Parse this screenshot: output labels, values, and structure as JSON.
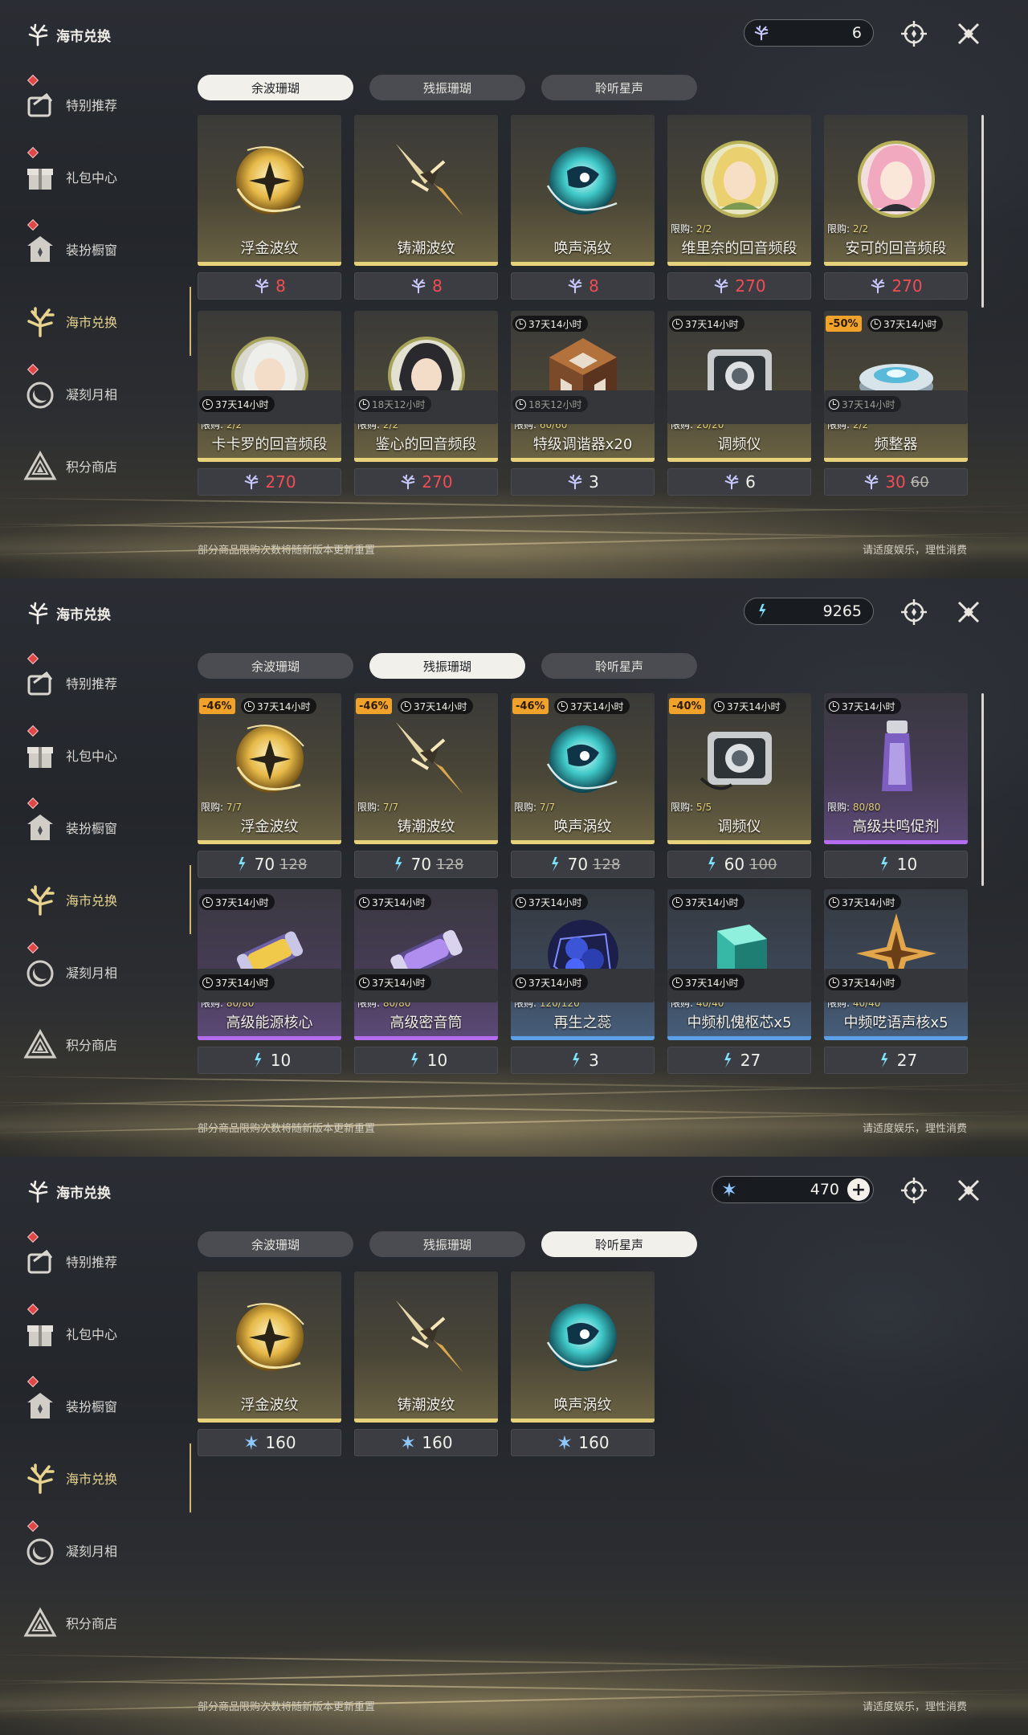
{
  "app_title": "海市兑换",
  "sidebar": [
    {
      "label": "特别推荐",
      "icon": "featured-icon",
      "dot": true
    },
    {
      "label": "礼包中心",
      "icon": "gift-box-icon",
      "dot": true
    },
    {
      "label": "装扮橱窗",
      "icon": "wardrobe-icon",
      "dot": true
    },
    {
      "label": "海市兑换",
      "icon": "coral-exchange-icon",
      "active": true
    },
    {
      "label": "凝刻月相",
      "icon": "moon-phase-icon",
      "dot": true
    },
    {
      "label": "积分商店",
      "icon": "points-shop-icon"
    }
  ],
  "tabs": [
    "余波珊瑚",
    "残振珊瑚",
    "聆听星声"
  ],
  "footer": {
    "left": "部分商品限购次数将随新版本更新重置",
    "right": "请适度娱乐，理性消费"
  },
  "colors": {
    "accent": "#e9d48f",
    "price_red": "#f04d55",
    "discount": "#f0a22b",
    "gold_bar": "#e7d27b",
    "purple_bar": "#b46cf0",
    "blue_bar": "#5b9fe6"
  },
  "panels": [
    {
      "currency": {
        "icon": "afterglow-coral-icon",
        "value": "6",
        "plus": false
      },
      "active_tab": 0,
      "items": [
        {
          "name": "浮金波纹",
          "art": "gold-orb",
          "price": "8",
          "price_red": true,
          "currency_icon": "afterglow-coral-icon"
        },
        {
          "name": "铸潮波纹",
          "art": "gold-blade",
          "price": "8",
          "price_red": true,
          "currency_icon": "afterglow-coral-icon"
        },
        {
          "name": "唤声涡纹",
          "art": "cyan-orb",
          "price": "8",
          "price_red": true,
          "currency_icon": "afterglow-coral-icon"
        },
        {
          "name": "维里奈的回音频段",
          "art": "portrait-blonde",
          "limit": "2/2",
          "price": "270",
          "price_red": true,
          "currency_icon": "afterglow-coral-icon"
        },
        {
          "name": "安可的回音频段",
          "art": "portrait-pink",
          "limit": "2/2",
          "price": "270",
          "price_red": true,
          "currency_icon": "afterglow-coral-icon"
        },
        {
          "name": "卡卡罗的回音频段",
          "art": "portrait-white",
          "limit": "2/2",
          "price": "270",
          "price_red": true,
          "currency_icon": "afterglow-coral-icon"
        },
        {
          "name": "鉴心的回音频段",
          "art": "portrait-dark",
          "limit": "2/2",
          "price": "270",
          "price_red": true,
          "currency_icon": "afterglow-coral-icon"
        },
        {
          "name": "特级调谐器x20",
          "art": "tuner-die",
          "limit": "60/60",
          "timer": "37天14小时",
          "price": "3",
          "currency_icon": "afterglow-coral-icon"
        },
        {
          "name": "调频仪",
          "art": "tuning-device",
          "limit": "20/20",
          "timer": "37天14小时",
          "price": "6",
          "currency_icon": "afterglow-coral-icon"
        },
        {
          "name": "频整器",
          "art": "disc-device",
          "limit": "2/2",
          "timer": "37天14小时",
          "discount": "-50%",
          "price": "30",
          "old_price": "60",
          "price_red": true,
          "currency_icon": "afterglow-coral-icon"
        }
      ],
      "peek": [
        {
          "timer": "37天14小时",
          "dim": false
        },
        {
          "timer": "18天12小时",
          "dim": true
        },
        {
          "timer": "18天12小时",
          "dim": true
        },
        {
          "timer": "",
          "dim": true
        },
        {
          "timer": "37天14小时",
          "dim": true
        }
      ]
    },
    {
      "currency": {
        "icon": "oscillate-coral-icon",
        "value": "9265",
        "plus": false
      },
      "active_tab": 1,
      "items": [
        {
          "name": "浮金波纹",
          "art": "gold-orb",
          "limit": "7/7",
          "timer": "37天14小时",
          "discount": "-46%",
          "price": "70",
          "old_price": "128",
          "currency_icon": "oscillate-coral-icon"
        },
        {
          "name": "铸潮波纹",
          "art": "gold-blade",
          "limit": "7/7",
          "timer": "37天14小时",
          "discount": "-46%",
          "price": "70",
          "old_price": "128",
          "currency_icon": "oscillate-coral-icon"
        },
        {
          "name": "唤声涡纹",
          "art": "cyan-orb",
          "limit": "7/7",
          "timer": "37天14小时",
          "discount": "-46%",
          "price": "70",
          "old_price": "128",
          "currency_icon": "oscillate-coral-icon"
        },
        {
          "name": "调频仪",
          "art": "tuning-device",
          "limit": "5/5",
          "timer": "37天14小时",
          "discount": "-40%",
          "price": "60",
          "old_price": "100",
          "currency_icon": "oscillate-coral-icon"
        },
        {
          "name": "高级共鸣促剂",
          "art": "vial-purple",
          "limit": "80/80",
          "timer": "37天14小时",
          "price": "10",
          "rarity": "purple",
          "currency_icon": "oscillate-coral-icon"
        },
        {
          "name": "高级能源核心",
          "art": "capsule-gold",
          "limit": "80/80",
          "timer": "37天14小时",
          "price": "10",
          "rarity": "purple",
          "currency_icon": "oscillate-coral-icon"
        },
        {
          "name": "高级密音筒",
          "art": "capsule-purple",
          "limit": "80/80",
          "timer": "37天14小时",
          "price": "10",
          "rarity": "purple",
          "currency_icon": "oscillate-coral-icon"
        },
        {
          "name": "再生之蕊",
          "art": "crystal-cluster",
          "limit": "120/120",
          "timer": "37天14小时",
          "price": "3",
          "rarity": "blue",
          "currency_icon": "oscillate-coral-icon"
        },
        {
          "name": "中频机傀枢芯x5",
          "art": "teal-cube",
          "limit": "40/40",
          "timer": "37天14小时",
          "price": "27",
          "rarity": "blue",
          "currency_icon": "oscillate-coral-icon"
        },
        {
          "name": "中频呓语声核x5",
          "art": "gold-star",
          "limit": "40/40",
          "timer": "37天14小时",
          "price": "27",
          "rarity": "blue",
          "currency_icon": "oscillate-coral-icon"
        }
      ],
      "peek": [
        {
          "timer": "37天14小时",
          "dim": false
        },
        {
          "timer": "37天14小时",
          "dim": false
        },
        {
          "timer": "37天14小时",
          "dim": false
        },
        {
          "timer": "37天14小时",
          "dim": false
        },
        {
          "timer": "37天14小时",
          "dim": false
        }
      ]
    },
    {
      "currency": {
        "icon": "star-voice-icon",
        "value": "470",
        "plus": true
      },
      "active_tab": 2,
      "items": [
        {
          "name": "浮金波纹",
          "art": "gold-orb",
          "price": "160",
          "currency_icon": "star-voice-icon"
        },
        {
          "name": "铸潮波纹",
          "art": "gold-blade",
          "price": "160",
          "currency_icon": "star-voice-icon"
        },
        {
          "name": "唤声涡纹",
          "art": "cyan-orb",
          "price": "160",
          "currency_icon": "star-voice-icon"
        }
      ],
      "peek": []
    }
  ]
}
